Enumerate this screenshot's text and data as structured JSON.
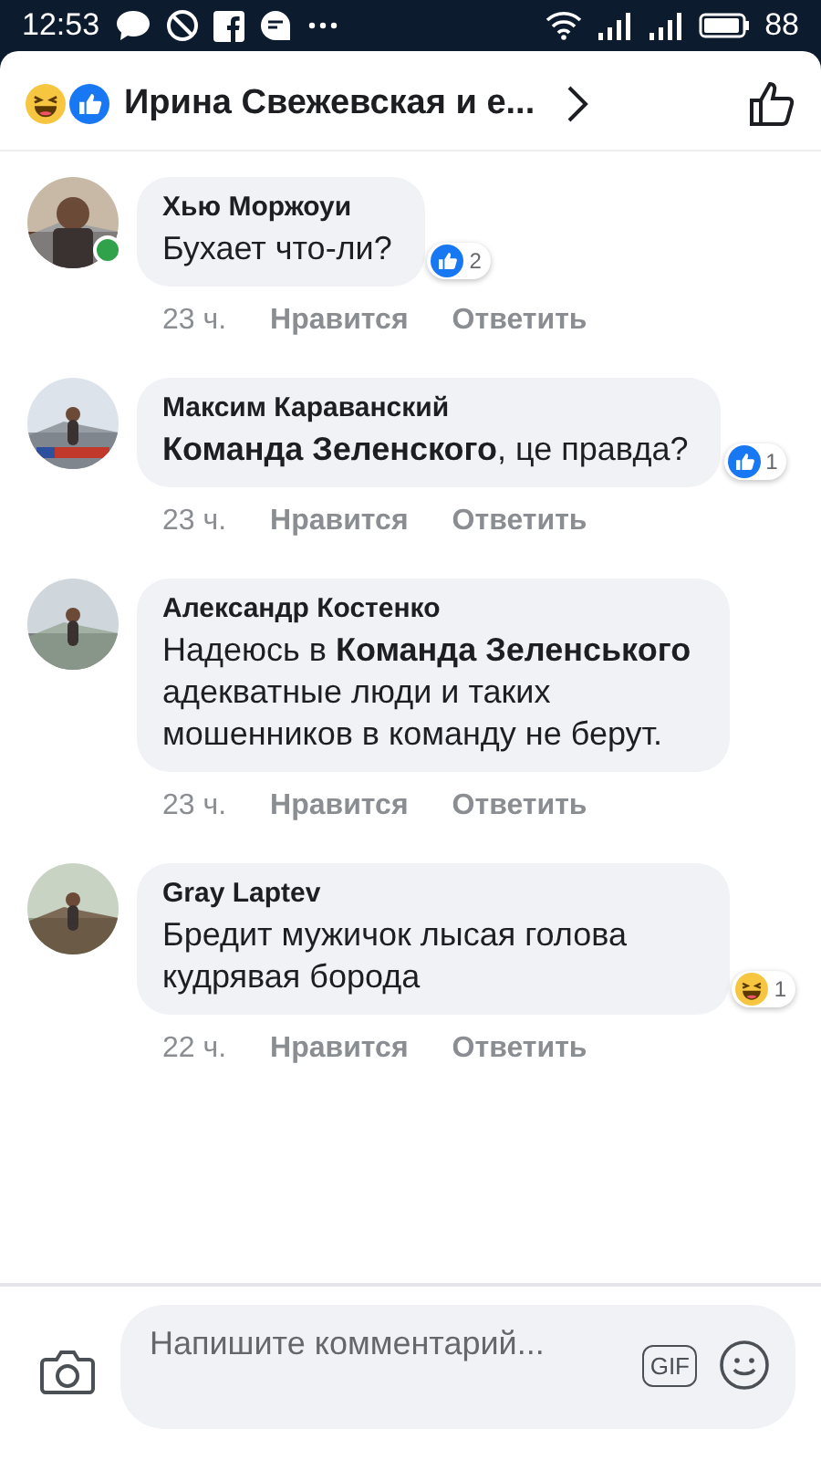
{
  "status_bar": {
    "time": "12:53",
    "battery": "88"
  },
  "header": {
    "title": "Ирина Свежевская и е..."
  },
  "comments": [
    {
      "author": "Хью Моржоуи",
      "online": true,
      "text": "Бухает что-ли?",
      "reaction": {
        "kind": "like",
        "count": "2"
      },
      "time": "23 ч.",
      "like_label": "Нравится",
      "reply_label": "Ответить"
    },
    {
      "author": "Максим Караванский",
      "online": false,
      "text": "**Команда Зеленского**, це правда?",
      "reaction": {
        "kind": "like",
        "count": "1"
      },
      "time": "23 ч.",
      "like_label": "Нравится",
      "reply_label": "Ответить"
    },
    {
      "author": "Александр Костенко",
      "online": false,
      "text": "Надеюсь в **Команда Зеленського** адекватные люди и таких мошенников в команду не берут.",
      "time": "23 ч.",
      "like_label": "Нравится",
      "reply_label": "Ответить"
    },
    {
      "author": "Gray Laptev",
      "online": false,
      "text": "Бредит мужичок лысая голова кудрявая борода",
      "reaction": {
        "kind": "haha",
        "count": "1"
      },
      "time": "22 ч.",
      "like_label": "Нравится",
      "reply_label": "Ответить"
    }
  ],
  "composer": {
    "placeholder": "Напишите комментарий...",
    "gif_label": "GIF"
  }
}
